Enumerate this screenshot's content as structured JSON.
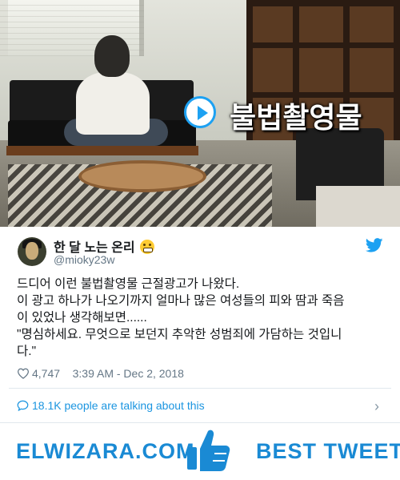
{
  "media": {
    "caption": "불법촬영물"
  },
  "tweet": {
    "display_name": "한 달 노는 온리",
    "handle": "@mioky23w",
    "lines": [
      "드디어 이런 불법촬영물 근절광고가 나왔다.",
      "이 광고 하나가 나오기까지 얼마나 많은 여성들의 피와 땀과 죽음",
      "이 있었나 생각해보면......",
      "\"명심하세요. 무엇으로 보던지 추악한 성범죄에 가담하는 것입니",
      "다.\""
    ],
    "likes": "4,747",
    "timestamp": "3:39 AM - Dec 2, 2018",
    "talking": "18.1K people are talking about this"
  },
  "banner": {
    "left": "ELWIZARA.COM",
    "right": "BEST TWEETS"
  },
  "colors": {
    "accent": "#1da1f2",
    "brand": "#1a8ad4",
    "muted": "#657786"
  }
}
